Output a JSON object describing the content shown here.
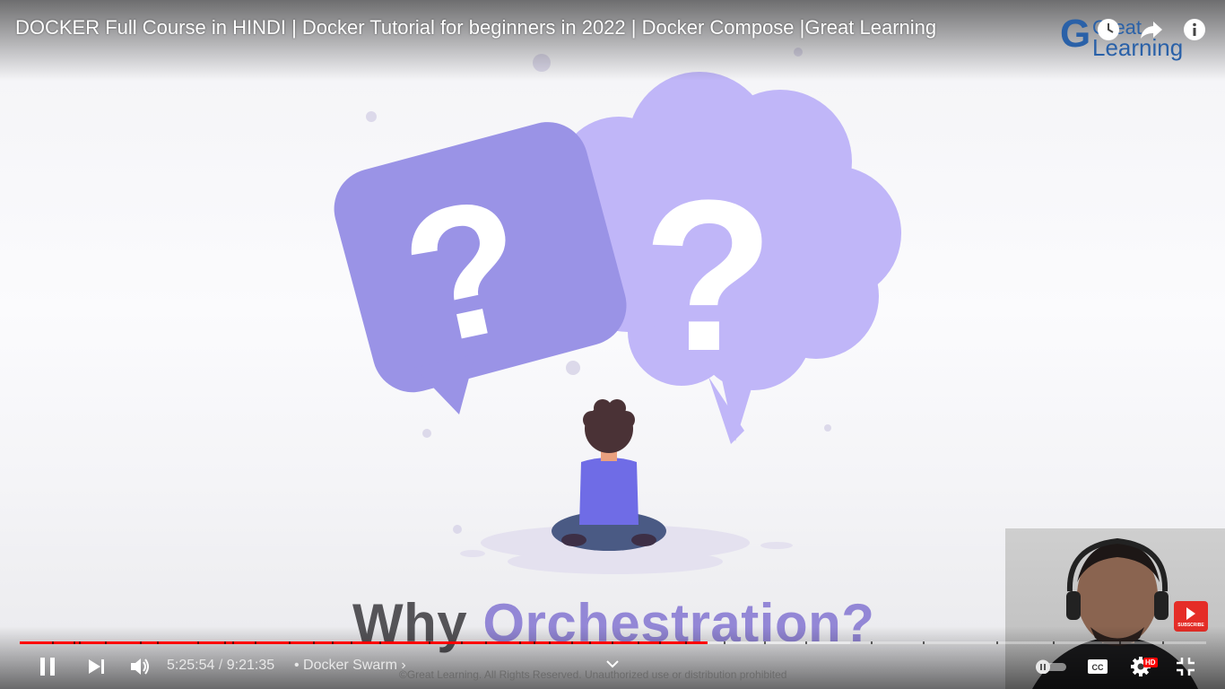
{
  "video": {
    "title": "DOCKER Full Course in HINDI | Docker Tutorial for beginners in 2022 | Docker Compose |Great Learning",
    "brand_logo_text": "Great Learning",
    "scene_text_word1": "Why",
    "scene_text_word2": "Orchestration?",
    "copyright": "©Great Learning. All Rights Reserved. Unauthorized use or distribution prohibited",
    "subscribe_watermark": "SUBSCRIBE"
  },
  "top_controls": [
    {
      "name": "watch-later",
      "icon": "clock-icon"
    },
    {
      "name": "share",
      "icon": "share-arrow-icon"
    },
    {
      "name": "info",
      "icon": "info-icon"
    }
  ],
  "controls": {
    "current_time": "5:25:54",
    "separator": " / ",
    "duration": "9:21:35",
    "chapter_prefix": " • ",
    "chapter_title": "Docker Swarm",
    "chapter_arrow": "›",
    "hd_badge": "HD",
    "progress_played_fraction": 0.5795,
    "progress_loaded_fraction": 0.7,
    "chapter_markers": [
      0.027,
      0.045,
      0.05,
      0.072,
      0.101,
      0.116,
      0.15,
      0.172,
      0.179,
      0.198,
      0.227,
      0.247,
      0.263,
      0.279,
      0.303,
      0.345,
      0.372,
      0.392,
      0.421,
      0.433,
      0.446,
      0.465,
      0.48,
      0.499,
      0.521,
      0.539,
      0.561,
      0.593,
      0.627,
      0.662,
      0.717,
      0.761,
      0.823,
      0.871,
      0.927,
      0.963
    ]
  },
  "colors": {
    "progress_red": "#ff0000",
    "bubble_dark": "#9a93e6",
    "bubble_light": "#c0b6f8",
    "shirt": "#6f6ce6",
    "pants": "#4a5a84",
    "hair": "#4a3236",
    "scene_word1": "#555458",
    "scene_word2": "#9387d6"
  }
}
